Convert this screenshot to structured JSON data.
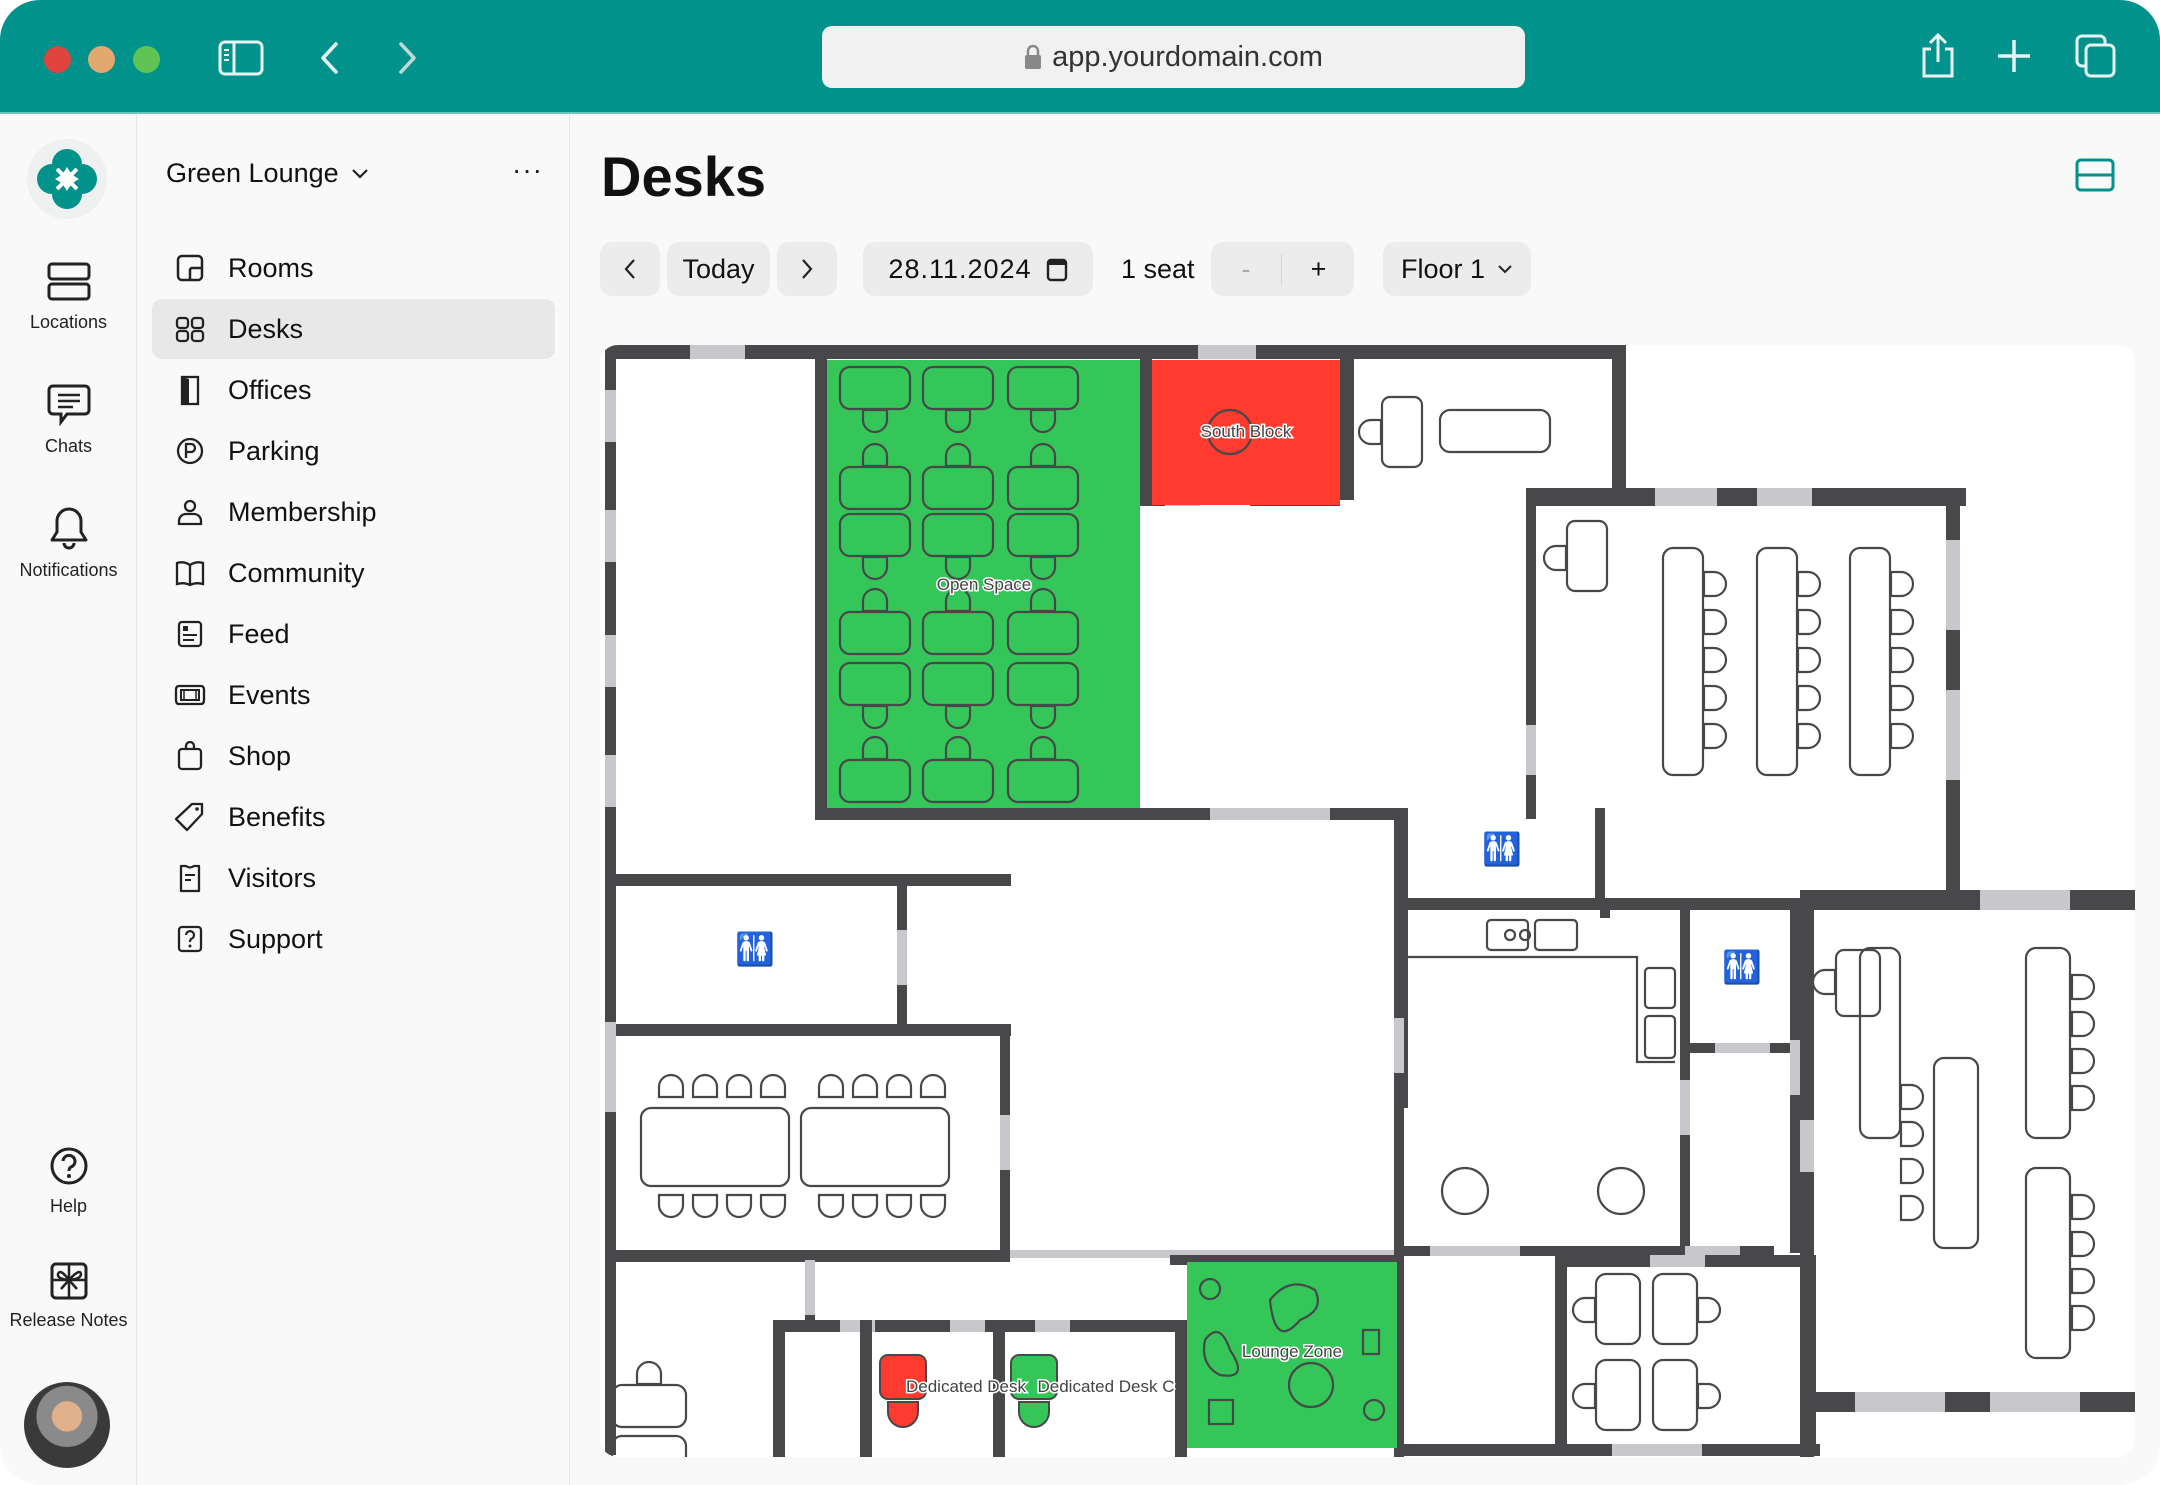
{
  "browser": {
    "url": "app.yourdomain.com",
    "traffic_lights": [
      "#e0443e",
      "#e2a86f",
      "#5fc454"
    ],
    "icons": [
      "sidebar-toggle-icon",
      "back-icon",
      "forward-icon",
      "share-icon",
      "new-tab-icon",
      "tabs-overview-icon"
    ]
  },
  "colors": {
    "brand": "#00928b",
    "available": "#34c659",
    "booked": "#ff3b2f",
    "wall": "#48484a",
    "window": "#c7c7cc"
  },
  "rail": {
    "items": [
      {
        "label": "Locations",
        "icon": "locations-icon"
      },
      {
        "label": "Chats",
        "icon": "chat-icon"
      },
      {
        "label": "Notifications",
        "icon": "bell-icon"
      }
    ],
    "bottom": [
      {
        "label": "Help",
        "icon": "help-icon"
      },
      {
        "label": "Release Notes",
        "icon": "gift-icon"
      }
    ]
  },
  "nav": {
    "location": "Green Lounge",
    "more_label": "···",
    "items": [
      {
        "label": "Rooms",
        "icon": "rooms-icon",
        "active": false
      },
      {
        "label": "Desks",
        "icon": "desks-icon",
        "active": true
      },
      {
        "label": "Offices",
        "icon": "door-icon",
        "active": false
      },
      {
        "label": "Parking",
        "icon": "parking-icon",
        "active": false
      },
      {
        "label": "Membership",
        "icon": "person-icon",
        "active": false
      },
      {
        "label": "Community",
        "icon": "book-icon",
        "active": false
      },
      {
        "label": "Feed",
        "icon": "feed-icon",
        "active": false
      },
      {
        "label": "Events",
        "icon": "ticket-icon",
        "active": false
      },
      {
        "label": "Shop",
        "icon": "bag-icon",
        "active": false
      },
      {
        "label": "Benefits",
        "icon": "tag-icon",
        "active": false
      },
      {
        "label": "Visitors",
        "icon": "badge-icon",
        "active": false
      },
      {
        "label": "Support",
        "icon": "support-icon",
        "active": false
      }
    ]
  },
  "main": {
    "title": "Desks",
    "toolbar": {
      "prev_label": "‹",
      "today_label": "Today",
      "next_label": "›",
      "date": "28.11.2024",
      "seats_label": "1 seat",
      "decrement_label": "-",
      "increment_label": "+",
      "floor": "Floor 1"
    }
  },
  "floorplan": {
    "zones": [
      {
        "name": "Open Space",
        "status": "available"
      },
      {
        "name": "South Block",
        "status": "booked"
      },
      {
        "name": "Lounge Zone",
        "status": "available"
      },
      {
        "name": "Dedicated Desk",
        "status": "booked"
      },
      {
        "name": "Dedicated Desk C",
        "status": "available"
      }
    ]
  }
}
